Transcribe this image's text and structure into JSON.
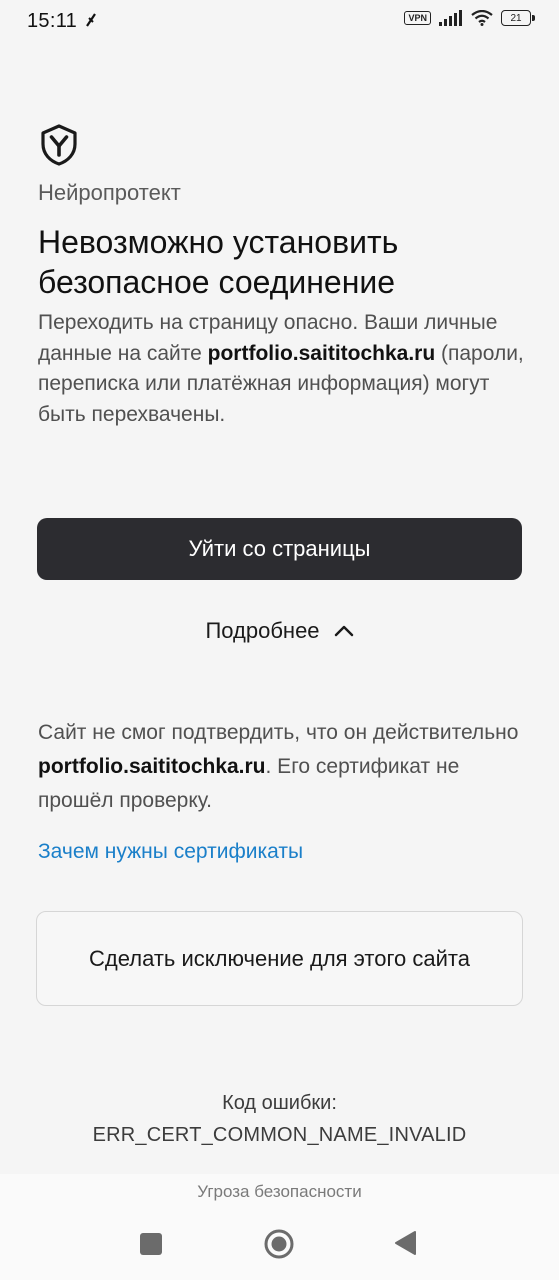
{
  "status_bar": {
    "time": "15:11",
    "vpn_label": "VPN",
    "battery_level": "21"
  },
  "page": {
    "brand": "Нейропротект",
    "heading": "Невозможно установить безопасное соединение",
    "description": {
      "before": "Переходить на страницу опасно. Ваши личные данные на сайте ",
      "domain": "portfolio.saititochka.ru",
      "after": " (пароли, переписка или платёжная информация) могут быть перехвачены."
    },
    "leave_button_label": "Уйти со страницы",
    "details_label": "Подробнее",
    "cert_text": {
      "before": "Сайт не смог подтвердить, что он действительно ",
      "domain": "portfolio.saititochka.ru",
      "after": ". Его сертификат не прошёл проверку."
    },
    "cert_link_label": "Зачем нужны сертификаты",
    "exception_button_label": "Сделать исключение для этого сайта",
    "error_label": "Код ошибки:",
    "error_code": "ERR_CERT_COMMON_NAME_INVALID"
  },
  "footer": {
    "title": "Угроза безопасности"
  },
  "icons": {
    "shield": "shield-icon",
    "chevron": "chevron-up-icon",
    "nav_recents": "square-icon",
    "nav_home": "home-circle-icon",
    "nav_back": "back-triangle-icon"
  },
  "colors": {
    "background": "#f5f5f5",
    "primary_button": "#2c2c30",
    "link": "#1a7fc9"
  }
}
